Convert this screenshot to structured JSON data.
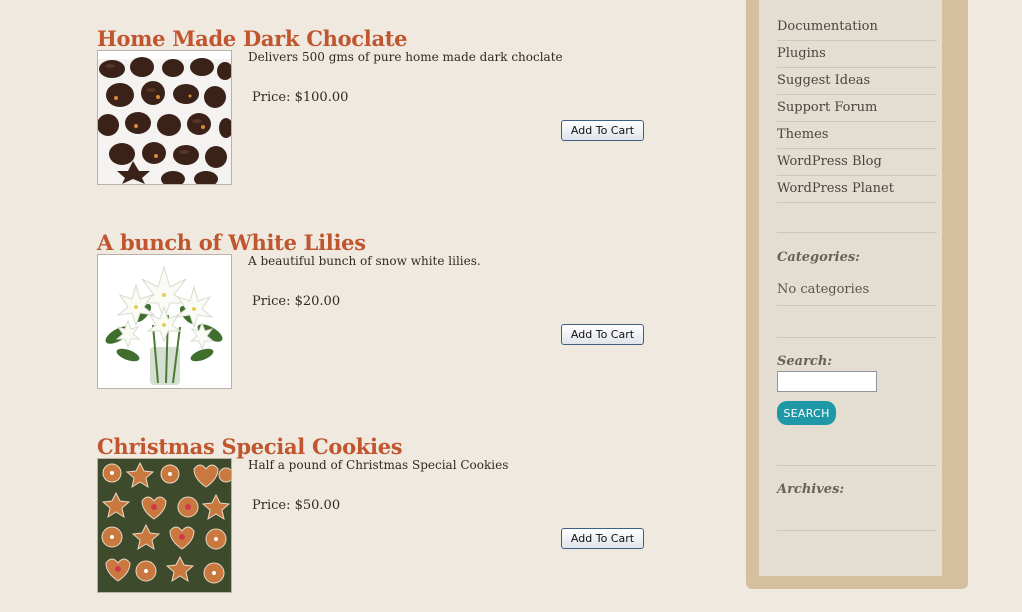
{
  "products": [
    {
      "title": "Home Made Dark Choclate",
      "description": "Delivers 500 gms of pure home made dark choclate",
      "price": "Price: $100.00",
      "button_label": "Add To Cart"
    },
    {
      "title": "A bunch of White Lilies",
      "description": "A beautiful bunch of snow white lilies.",
      "price": "Price: $20.00",
      "button_label": "Add To Cart"
    },
    {
      "title": "Christmas Special Cookies",
      "description": "Half a pound of Christmas Special Cookies",
      "price": "Price: $50.00",
      "button_label": "Add To Cart"
    }
  ],
  "sidebar": {
    "links": [
      "Documentation",
      "Plugins",
      "Suggest Ideas",
      "Support Forum",
      "Themes",
      "WordPress Blog",
      "WordPress Planet"
    ],
    "categories_title": "Categories:",
    "categories_empty": "No categories",
    "search_title": "Search:",
    "search_value": "",
    "search_button": "SEARCH",
    "archives_title": "Archives:"
  },
  "colors": {
    "page_bg": "#efe9e0",
    "title": "#c0562f",
    "sidebar_border": "#d4bf9f",
    "sidebar_bg": "#e4ddd2",
    "search_button": "#1e98a6"
  }
}
